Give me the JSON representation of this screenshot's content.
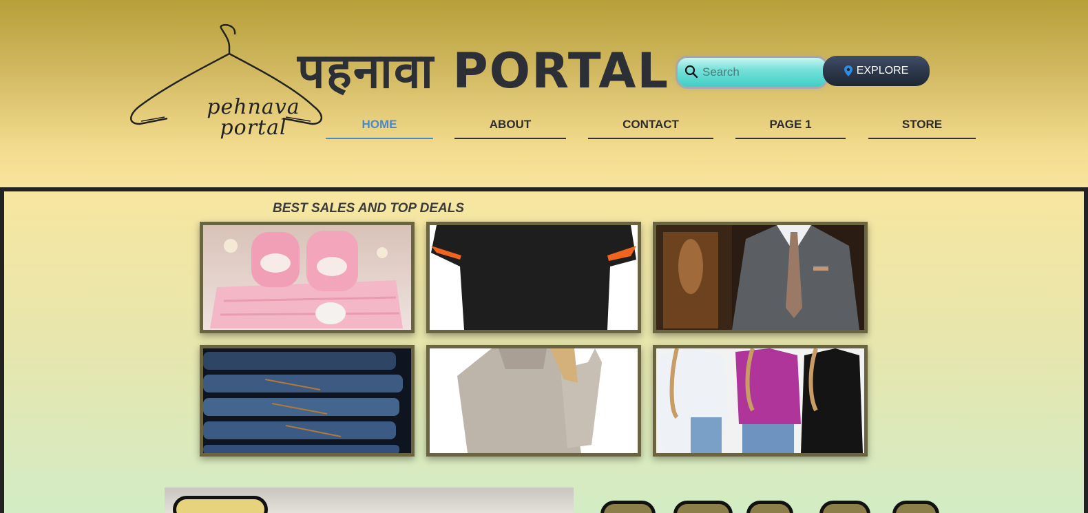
{
  "header": {
    "site_title": "पहनावा PORTAL",
    "logo_text_line1": "pehnava",
    "logo_text_line2": "portal",
    "search": {
      "placeholder": "Search"
    },
    "explore_label": "EXPLORE",
    "nav": [
      {
        "label": "HOME",
        "active": true
      },
      {
        "label": "ABOUT",
        "active": false
      },
      {
        "label": "CONTACT",
        "active": false
      },
      {
        "label": "PAGE 1",
        "active": false
      },
      {
        "label": "STORE",
        "active": false
      }
    ]
  },
  "main": {
    "section_title": "BEST SALES AND TOP DEALS",
    "tiles": [
      {
        "image": "baby-booties-and-clothes-image"
      },
      {
        "image": "black-tshirt-image"
      },
      {
        "image": "grey-suit-image"
      },
      {
        "image": "stacked-jeans-image"
      },
      {
        "image": "beige-sweater-image"
      },
      {
        "image": "womens-tops-image"
      }
    ]
  },
  "colors": {
    "accent_active": "#4a88c8",
    "tile_border": "#6b6440",
    "explore_bg": "#2a3447",
    "search_bg": "#3fcfc5"
  }
}
